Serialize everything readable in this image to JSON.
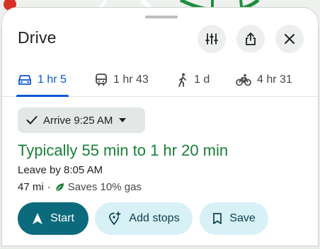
{
  "header": {
    "title": "Drive"
  },
  "tabs": [
    {
      "mode": "drive",
      "label": "1 hr 5",
      "icon": "car-icon",
      "active": true
    },
    {
      "mode": "transit",
      "label": "1 hr 43",
      "icon": "train-icon",
      "active": false
    },
    {
      "mode": "walk",
      "label": "1 d",
      "icon": "walk-icon",
      "active": false
    },
    {
      "mode": "bike",
      "label": "4 hr 31",
      "icon": "bike-icon",
      "active": false
    }
  ],
  "arrive": {
    "label": "Arrive 9:25 AM"
  },
  "summary": {
    "typical": "Typically 55 min to 1 hr 20 min",
    "leave_by": "Leave by 8:05 AM",
    "distance": "47 mi",
    "separator": "·",
    "gas": "Saves 10% gas"
  },
  "actions": {
    "start": "Start",
    "add_stops": "Add stops",
    "save": "Save"
  },
  "colors": {
    "accent_blue": "#0b57d0",
    "typical_green": "#188038",
    "start_teal": "#0b6b7c",
    "tonal_button": "#d7f1f7"
  }
}
